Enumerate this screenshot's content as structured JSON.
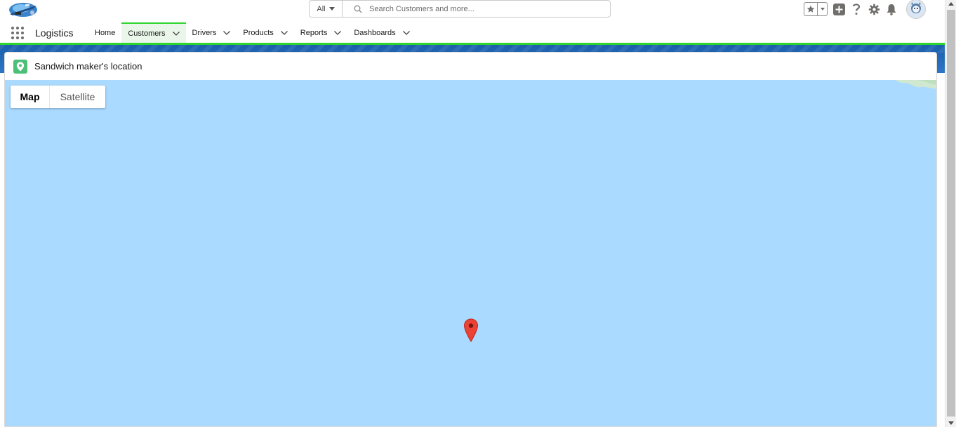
{
  "header": {
    "search_scope": "All",
    "search_placeholder": "Search Customers and more..."
  },
  "nav": {
    "app_name": "Logistics",
    "items": [
      {
        "label": "Home",
        "has_menu": false,
        "active": false
      },
      {
        "label": "Customers",
        "has_menu": true,
        "active": true
      },
      {
        "label": "Drivers",
        "has_menu": true,
        "active": false
      },
      {
        "label": "Products",
        "has_menu": true,
        "active": false
      },
      {
        "label": "Reports",
        "has_menu": true,
        "active": false
      },
      {
        "label": "Dashboards",
        "has_menu": true,
        "active": false
      }
    ]
  },
  "card": {
    "title": "Sandwich maker's location",
    "icon": "location-pin-icon"
  },
  "map": {
    "toggle": {
      "map_label": "Map",
      "satellite_label": "Satellite",
      "selected": "Map"
    },
    "water_color": "#aadaff",
    "marker_color": "#ea4335"
  },
  "colors": {
    "accent": "#2ed52e",
    "card_icon_bg": "#4bc076",
    "band_blue": "#1b5eab"
  }
}
